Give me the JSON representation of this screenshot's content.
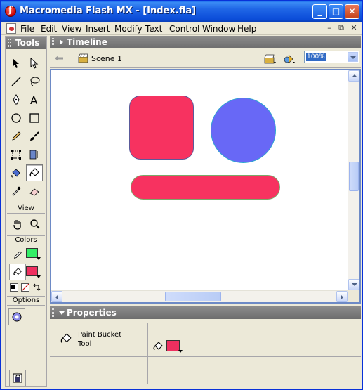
{
  "window": {
    "title": "Macromedia Flash MX - [Index.fla]",
    "minimize": "_",
    "maximize": "□",
    "close": "✕"
  },
  "menubar": {
    "items": [
      {
        "label": "File",
        "key": "F"
      },
      {
        "label": "Edit",
        "key": "E"
      },
      {
        "label": "View",
        "key": "V"
      },
      {
        "label": "Insert",
        "key": "I"
      },
      {
        "label": "Modify",
        "key": "M"
      },
      {
        "label": "Text",
        "key": "T"
      },
      {
        "label": "Control",
        "key": "C"
      },
      {
        "label": "Window",
        "key": "W"
      },
      {
        "label": "Help",
        "key": "H"
      }
    ],
    "doc_minimize": "–",
    "doc_restore": "⧉",
    "doc_close": "✕"
  },
  "tools": {
    "title": "Tools",
    "view_label": "View",
    "colors_label": "Colors",
    "options_label": "Options",
    "stroke_color": "#33ee66",
    "fill_color": "#ee2f5f"
  },
  "timeline": {
    "title": "Timeline"
  },
  "scene": {
    "label": "Scene 1",
    "zoom": "100%"
  },
  "stage": {
    "square_color": "#f73260",
    "circle_color": "#6868f6",
    "pill_color": "#f73260"
  },
  "properties": {
    "title": "Properties",
    "tool_name": "Paint Bucket Tool",
    "fill_color": "#ee2f5f"
  }
}
